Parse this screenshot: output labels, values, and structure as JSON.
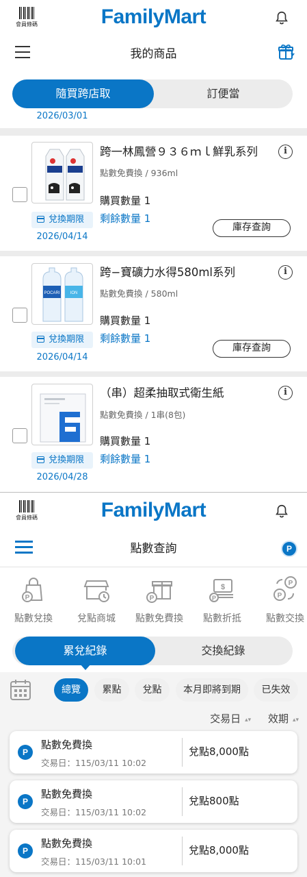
{
  "screen1": {
    "barcode_label": "會員條碼",
    "brand": "FamilyMart",
    "title": "我的商品",
    "tabs": [
      {
        "label": "隨買跨店取",
        "active": true
      },
      {
        "label": "訂便當",
        "active": false
      }
    ],
    "partial_date": "2026/03/01",
    "products": [
      {
        "name": "跨一林鳳營９３６ｍｌ鮮乳系列",
        "subtitle": "點數免費換 / 936ml",
        "qty": "購買數量 1",
        "remaining": "剩餘數量 1",
        "expiry_label": "兌換期限",
        "expiry_date": "2026/04/14",
        "stock_button": "庫存查詢"
      },
      {
        "name": "跨−寶礦力水得580ml系列",
        "subtitle": "點數免費換 / 580ml",
        "qty": "購買數量 1",
        "remaining": "剩餘數量 1",
        "expiry_label": "兌換期限",
        "expiry_date": "2026/04/14",
        "stock_button": "庫存查詢"
      },
      {
        "name": "（串）超柔抽取式衛生紙",
        "subtitle": "點數免費換 / 1串(8包)",
        "qty": "購買數量 1",
        "remaining": "剩餘數量 1",
        "expiry_label": "兌換期限",
        "expiry_date": "2026/04/28"
      }
    ]
  },
  "screen2": {
    "barcode_label": "會員條碼",
    "brand": "FamilyMart",
    "title": "點數查詢",
    "points_badge": "P",
    "categories": [
      "點數兌換",
      "兌點商城",
      "點數免費換",
      "點數折抵",
      "點數交換"
    ],
    "tabs": [
      {
        "label": "累兌紀錄",
        "active": true
      },
      {
        "label": "交換紀錄",
        "active": false
      }
    ],
    "filters": [
      {
        "label": "總覽",
        "active": true
      },
      {
        "label": "累點",
        "active": false
      },
      {
        "label": "兌點",
        "active": false
      },
      {
        "label": "本月即將到期",
        "active": false
      },
      {
        "label": "已失效",
        "active": false
      }
    ],
    "sort": {
      "date": "交易日",
      "expiry": "效期"
    },
    "records": [
      {
        "name": "點數免費換",
        "date": "交易日：115/03/11 10:02",
        "amount": "兌點8,000點"
      },
      {
        "name": "點數免費換",
        "date": "交易日：115/03/11 10:02",
        "amount": "兌點800點"
      },
      {
        "name": "點數免費換",
        "date": "交易日：115/03/11 10:01",
        "amount": "兌點8,000點"
      }
    ]
  },
  "colors": {
    "brand_blue": "#0a76c6",
    "chip_bg": "#f0f0f0",
    "divider": "#ececec"
  }
}
